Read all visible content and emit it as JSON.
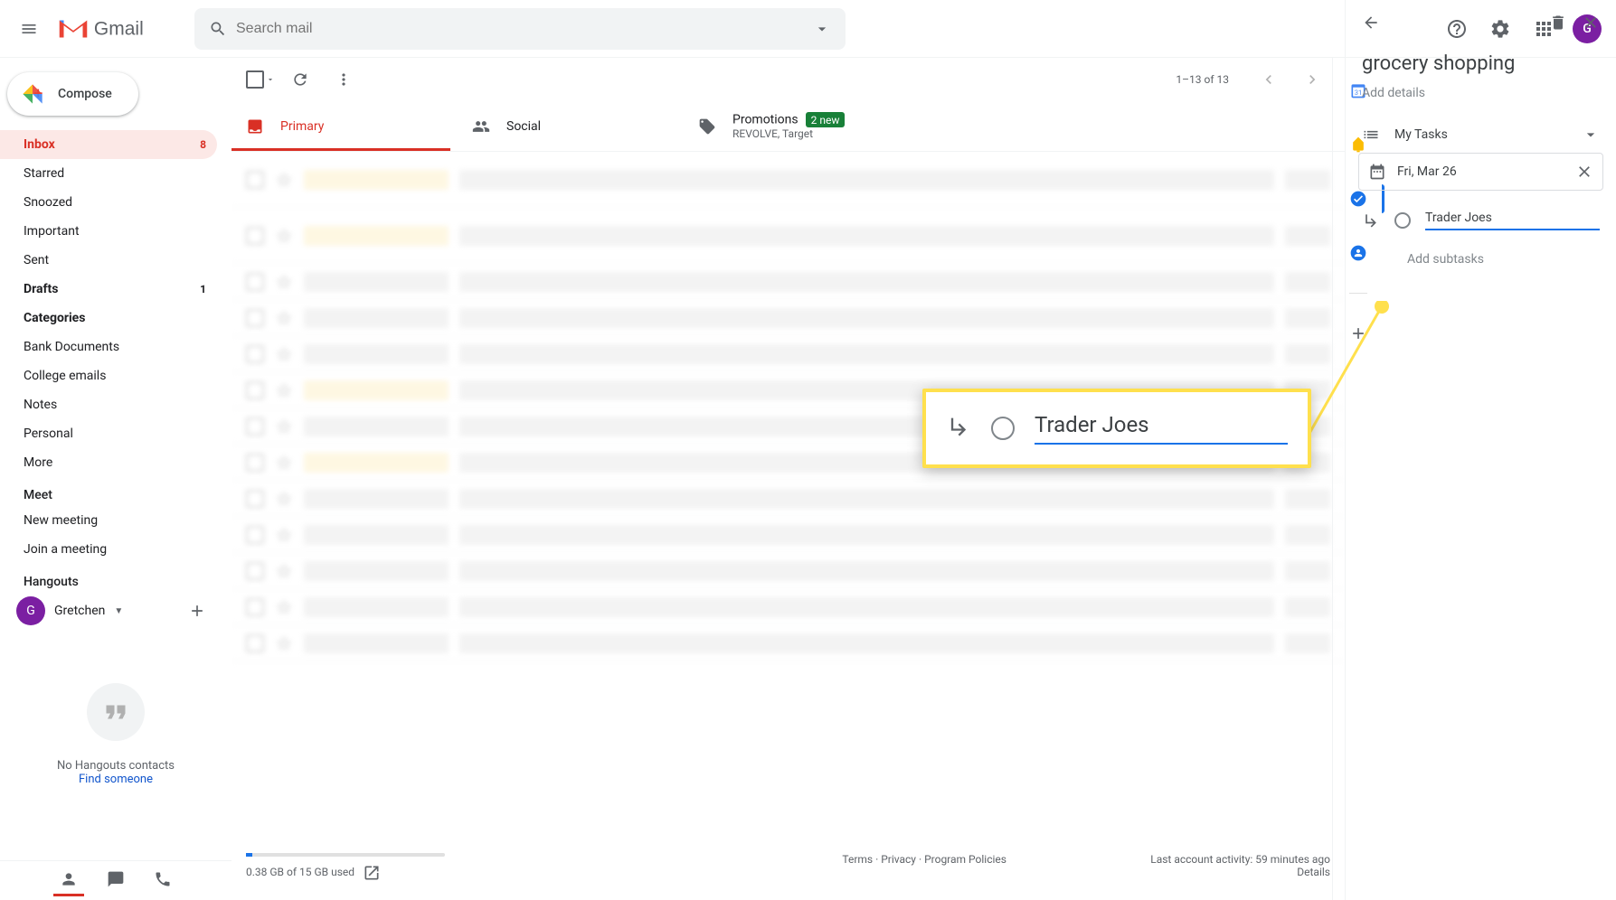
{
  "header": {
    "search_placeholder": "Search mail",
    "avatar_initial": "G"
  },
  "sidebar": {
    "compose_label": "Compose",
    "items": [
      {
        "label": "Inbox",
        "count": "8",
        "active": true,
        "bold": true
      },
      {
        "label": "Starred"
      },
      {
        "label": "Snoozed"
      },
      {
        "label": "Important"
      },
      {
        "label": "Sent"
      },
      {
        "label": "Drafts",
        "count": "1",
        "bold": true
      },
      {
        "label": "Categories",
        "bold": true
      },
      {
        "label": "Bank Documents"
      },
      {
        "label": "College emails"
      },
      {
        "label": "Notes"
      },
      {
        "label": "Personal"
      },
      {
        "label": "More"
      }
    ],
    "meet_header": "Meet",
    "meet_items": [
      {
        "label": "New meeting"
      },
      {
        "label": "Join a meeting"
      }
    ],
    "hangouts_header": "Hangouts",
    "hangouts_user": "Gretchen",
    "no_contacts_line": "No Hangouts contacts",
    "find_someone": "Find someone"
  },
  "toolbar": {
    "range": "1–13 of 13"
  },
  "tabs": [
    {
      "label": "Primary",
      "active": true
    },
    {
      "label": "Social"
    },
    {
      "label": "Promotions",
      "badge": "2 new",
      "sub": "REVOLVE, Target"
    }
  ],
  "footer": {
    "storage": "0.38 GB of 15 GB used",
    "links": {
      "terms": "Terms",
      "privacy": "Privacy",
      "policies": "Program Policies",
      "sep": " · "
    },
    "activity": "Last account activity: 59 minutes ago",
    "details": "Details"
  },
  "tasks": {
    "title": "grocery shopping",
    "details_placeholder": "Add details",
    "list_name": "My Tasks",
    "date": "Fri, Mar 26",
    "subtask_text": "Trader Joes",
    "add_subtasks": "Add subtasks"
  },
  "callout": {
    "text": "Trader Joes"
  }
}
